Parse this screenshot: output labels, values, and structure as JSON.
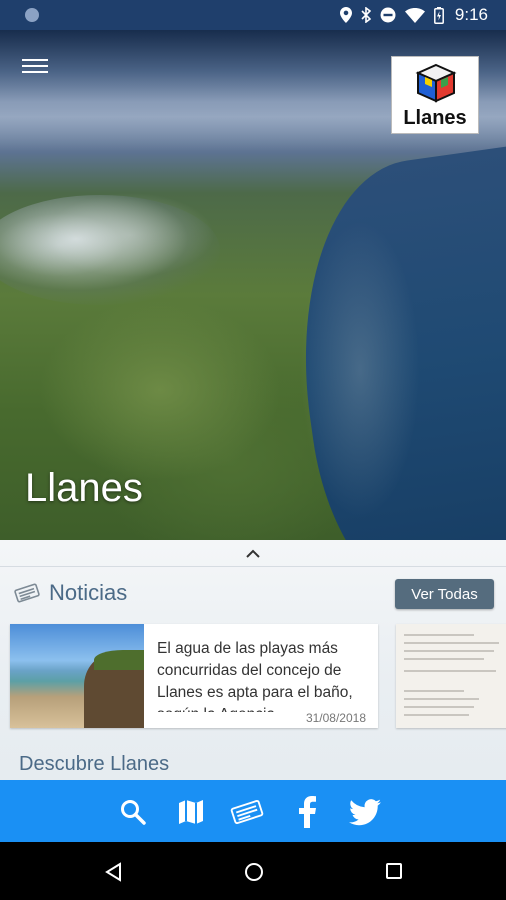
{
  "status_bar": {
    "time": "9:16"
  },
  "header": {
    "logo_text": "Llanes"
  },
  "hero": {
    "title": "Llanes"
  },
  "news": {
    "section_title": "Noticias",
    "view_all_label": "Ver Todas",
    "items": [
      {
        "text": "El agua de las playas más concurridas del concejo de Llanes es apta para el baño, según la Agencia",
        "date": "31/08/2018"
      }
    ]
  },
  "discover": {
    "section_title": "Descubre Llanes"
  },
  "bottom_nav": {
    "items": [
      "search-icon",
      "map-icon",
      "news-icon",
      "facebook-icon",
      "twitter-icon"
    ]
  },
  "colors": {
    "accent": "#1a90f4",
    "button": "#556c7e",
    "section_text": "#4b6a87"
  }
}
